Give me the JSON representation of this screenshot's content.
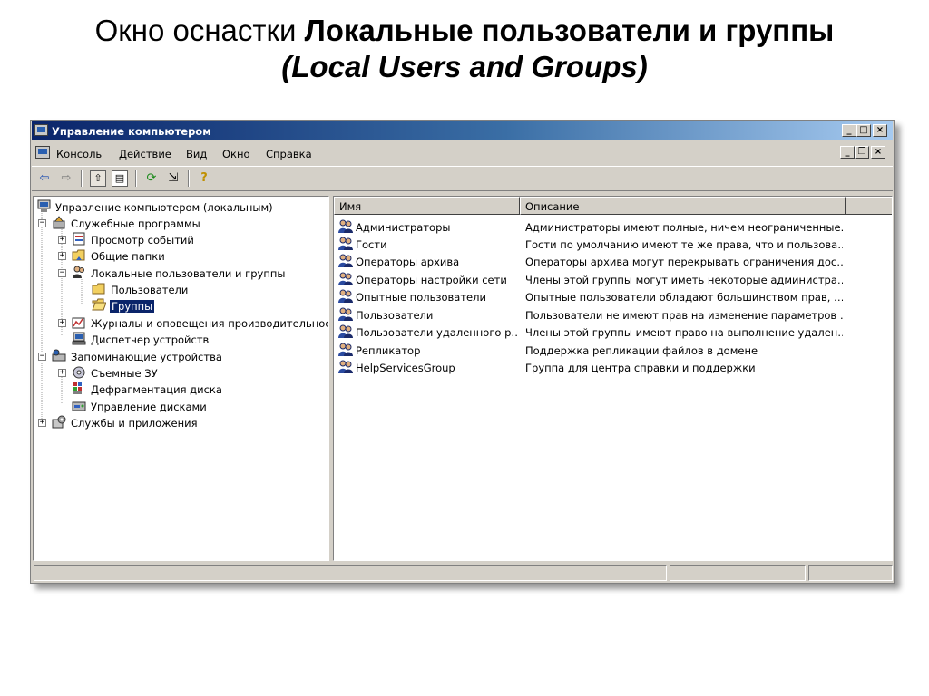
{
  "slide": {
    "title_normal": "Окно оснастки ",
    "title_bold": "Локальные пользователи и группы",
    "subtitle": "(Local Users and Groups)"
  },
  "window": {
    "title": "Управление компьютером",
    "menu": [
      "Консоль",
      "Действие",
      "Вид",
      "Окно",
      "Справка"
    ]
  },
  "tree": {
    "items": [
      {
        "label": "Управление компьютером (локальным)",
        "icon": "computer-icon"
      },
      {
        "label": "Служебные программы",
        "icon": "tools-icon"
      },
      {
        "label": "Просмотр событий",
        "icon": "event-viewer-icon"
      },
      {
        "label": "Общие папки",
        "icon": "shared-folder-icon"
      },
      {
        "label": "Локальные пользователи и группы",
        "icon": "users-icon"
      },
      {
        "label": "Пользователи",
        "icon": "folder-icon"
      },
      {
        "label": "Группы",
        "icon": "open-folder-icon"
      },
      {
        "label": "Журналы и оповещения производительност",
        "icon": "performance-logs-icon"
      },
      {
        "label": "Диспетчер устройств",
        "icon": "device-manager-icon"
      },
      {
        "label": "Запоминающие устройства",
        "icon": "storage-icon"
      },
      {
        "label": "Съемные ЗУ",
        "icon": "removable-storage-icon"
      },
      {
        "label": "Дефрагментация диска",
        "icon": "defrag-icon"
      },
      {
        "label": "Управление дисками",
        "icon": "disk-management-icon"
      },
      {
        "label": "Службы и приложения",
        "icon": "services-icon"
      }
    ]
  },
  "list": {
    "columns": [
      "Имя",
      "Описание"
    ],
    "rows": [
      {
        "name": "Администраторы",
        "description": "Администраторы имеют полные, ничем неограниченные…"
      },
      {
        "name": "Гости",
        "description": "Гости по умолчанию имеют те же права, что и пользова…"
      },
      {
        "name": "Операторы архива",
        "description": "Операторы архива могут перекрывать ограничения дос…"
      },
      {
        "name": "Операторы настройки сети",
        "description": "Члены этой группы могут иметь некоторые администра…"
      },
      {
        "name": "Опытные пользователи",
        "description": "Опытные пользователи обладают большинством прав, …"
      },
      {
        "name": "Пользователи",
        "description": "Пользователи не имеют прав на изменение параметров …"
      },
      {
        "name": "Пользователи удаленного р…",
        "description": "Члены этой группы имеют право на выполнение удален…"
      },
      {
        "name": "Репликатор",
        "description": "Поддержка репликации файлов в домене"
      },
      {
        "name": "HelpServicesGroup",
        "description": "Группа для центра справки и поддержки"
      }
    ]
  },
  "colors": {
    "titlebar_start": "#0a246a",
    "titlebar_end": "#a6caf0",
    "selection": "#0a246a",
    "window_face": "#d4d0c8"
  }
}
